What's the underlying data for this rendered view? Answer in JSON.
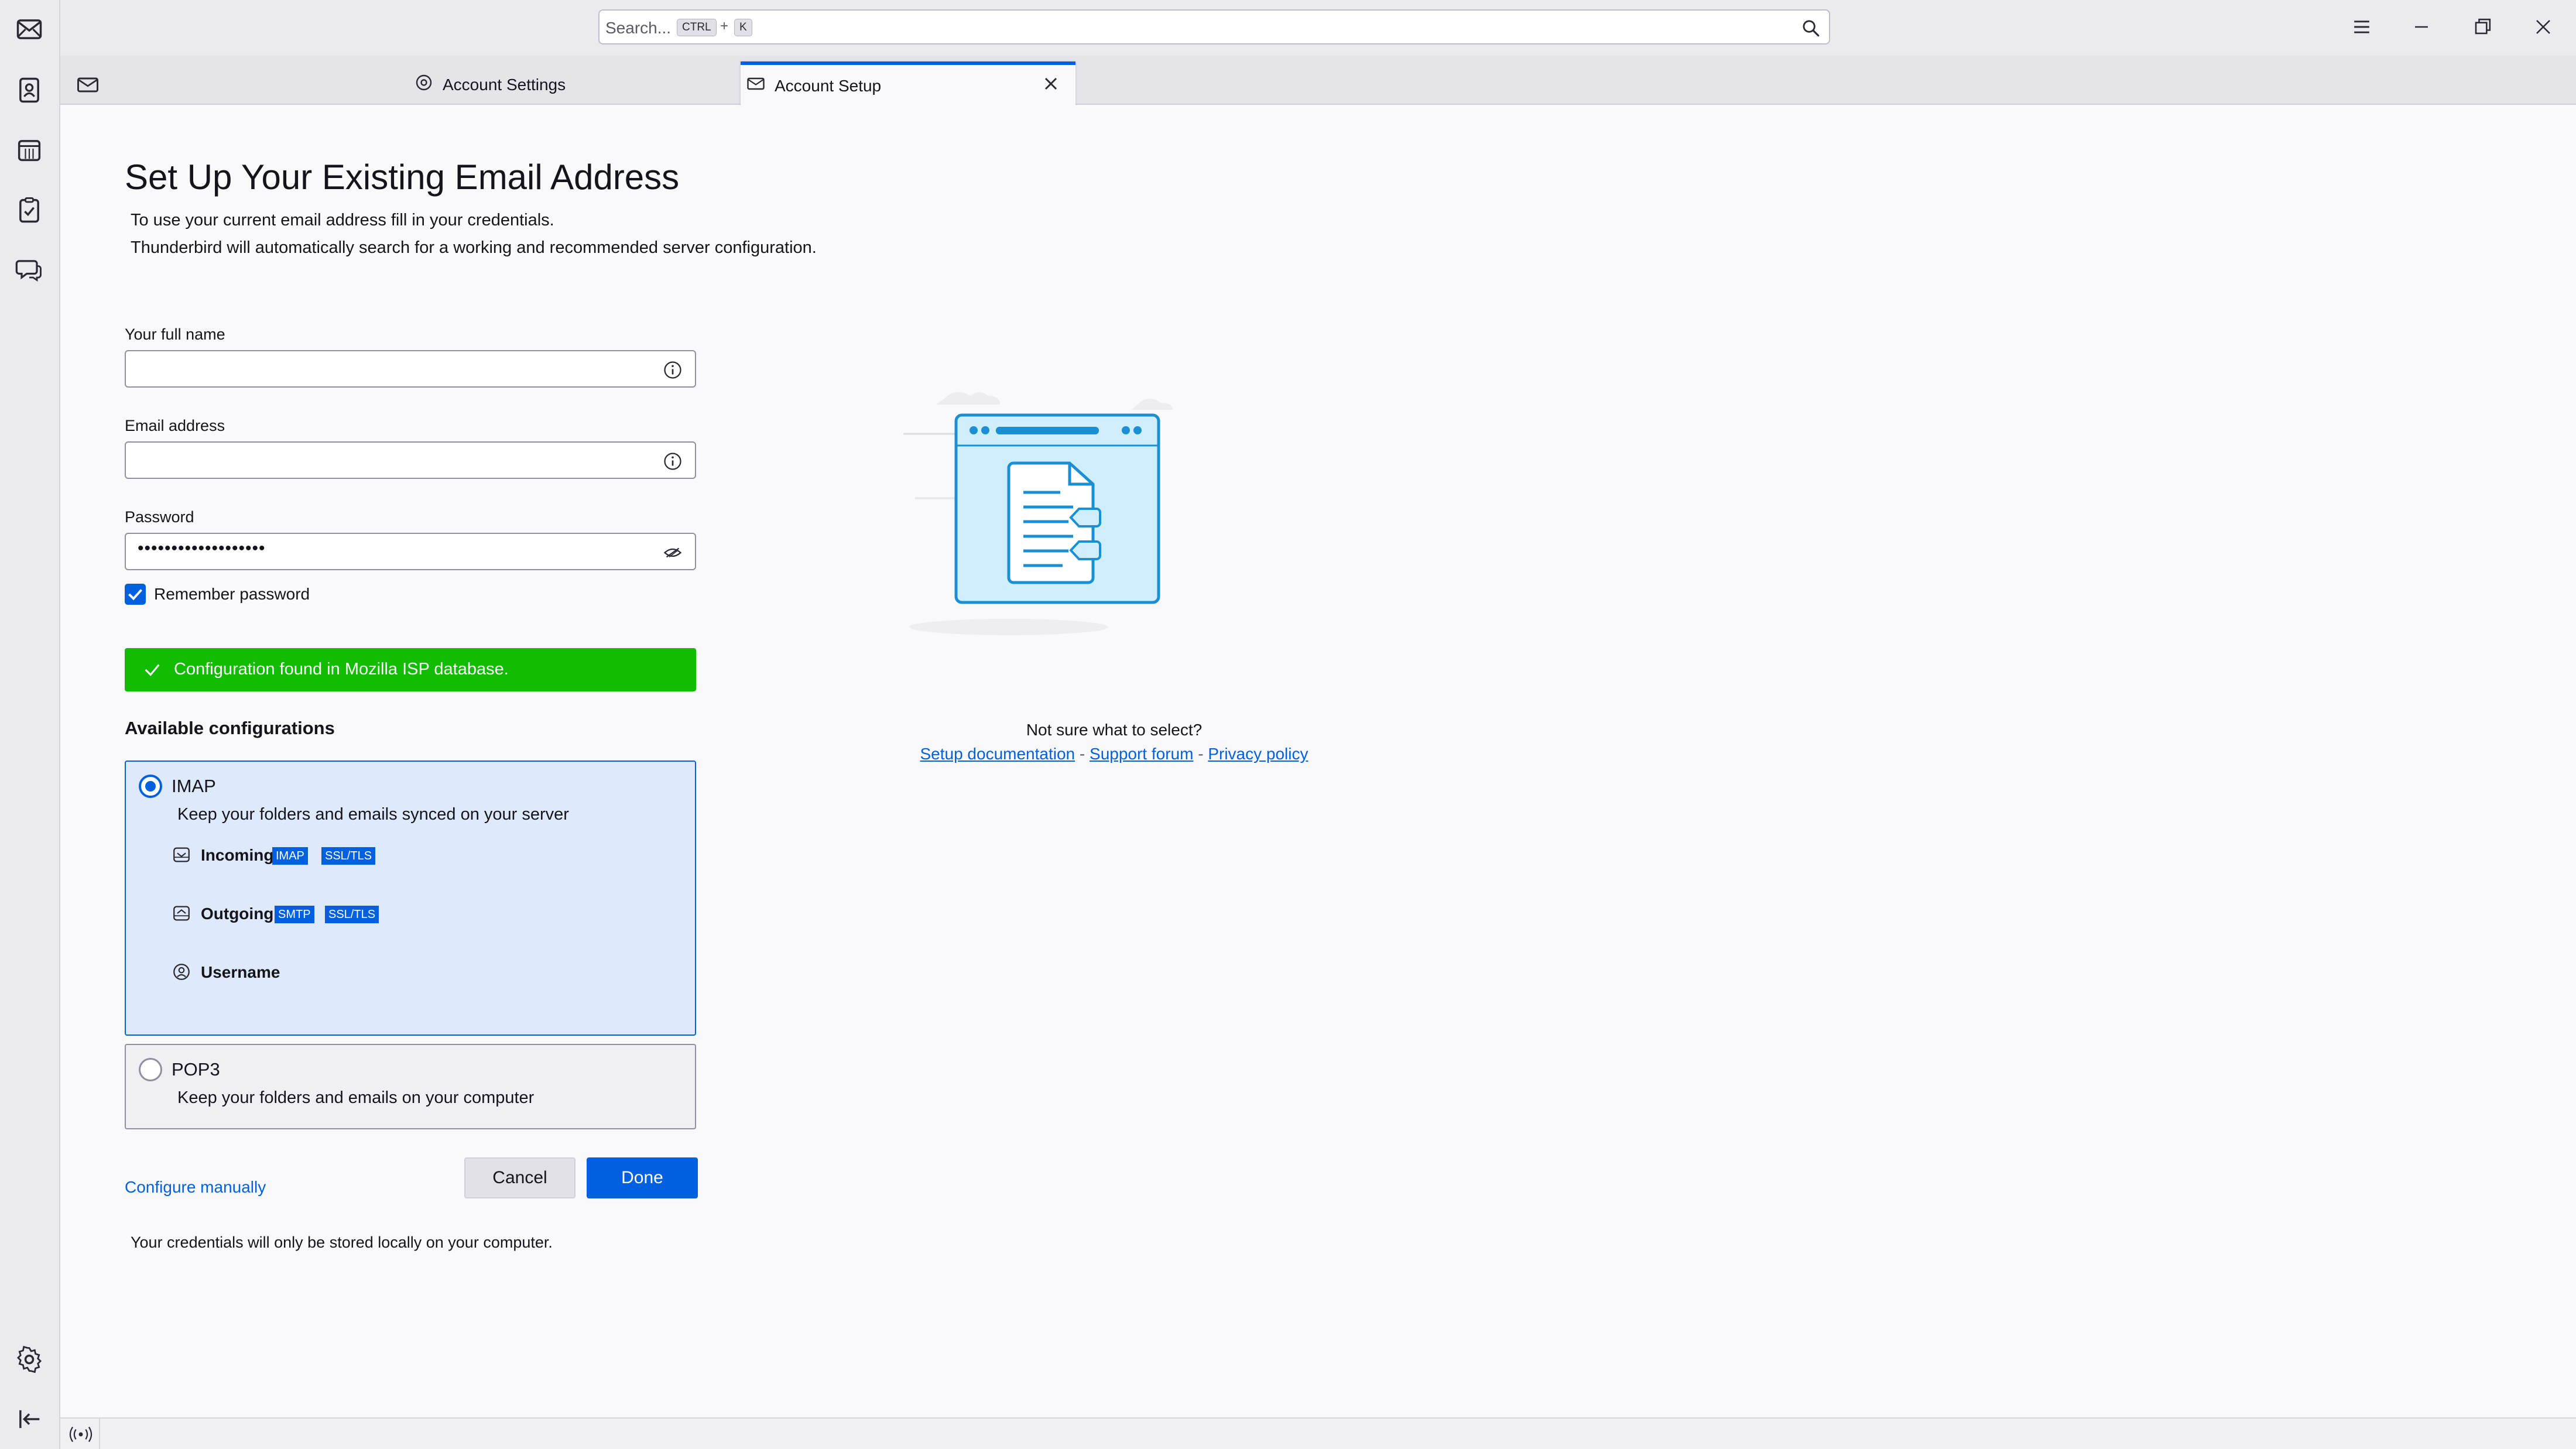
{
  "search": {
    "placeholder": "Search...",
    "shortcut_key1": "CTRL",
    "shortcut_plus": "+",
    "shortcut_key2": "K"
  },
  "spaces": {
    "items": [
      "mail",
      "address-book",
      "calendar",
      "tasks",
      "chat"
    ],
    "bottom": [
      "settings",
      "collapse"
    ]
  },
  "tabs": [
    {
      "label": "Account Settings",
      "icon": "gear-icon",
      "active": false
    },
    {
      "label": "Account Setup",
      "icon": "mail-setup-icon",
      "active": true
    }
  ],
  "page": {
    "title": "Set Up Your Existing Email Address",
    "intro_line1": "To use your current email address fill in your credentials.",
    "intro_line2": "Thunderbird will automatically search for a working and recommended server configuration."
  },
  "form": {
    "fullname_label": "Your full name",
    "fullname_value": "",
    "email_label": "Email address",
    "email_value": "",
    "password_label": "Password",
    "password_value": "•••••••••••••••••••",
    "remember_label": "Remember password",
    "remember_checked": true
  },
  "status": {
    "message": "Configuration found in Mozilla ISP database.",
    "color": "#12bc00"
  },
  "configs": {
    "title": "Available configurations",
    "imap": {
      "name": "IMAP",
      "description": "Keep your folders and emails synced on your server",
      "selected": true,
      "incoming_label": "Incoming",
      "incoming_badges": [
        "IMAP",
        "SSL/TLS"
      ],
      "outgoing_label": "Outgoing",
      "outgoing_badges": [
        "SMTP",
        "SSL/TLS"
      ],
      "username_label": "Username"
    },
    "pop3": {
      "name": "POP3",
      "description": "Keep your folders and emails on your computer",
      "selected": false
    }
  },
  "actions": {
    "configure_manually": "Configure manually",
    "cancel": "Cancel",
    "done": "Done"
  },
  "footer_note": "Your credentials will only be stored locally on your computer.",
  "help": {
    "question": "Not sure what to select?",
    "setup_doc": "Setup documentation",
    "sep1": " - ",
    "support_forum": "Support forum",
    "sep2": " - ",
    "privacy_policy": "Privacy policy"
  },
  "colors": {
    "accent": "#0060df",
    "success": "#12bc00",
    "selected_bg": "#deeafc"
  }
}
